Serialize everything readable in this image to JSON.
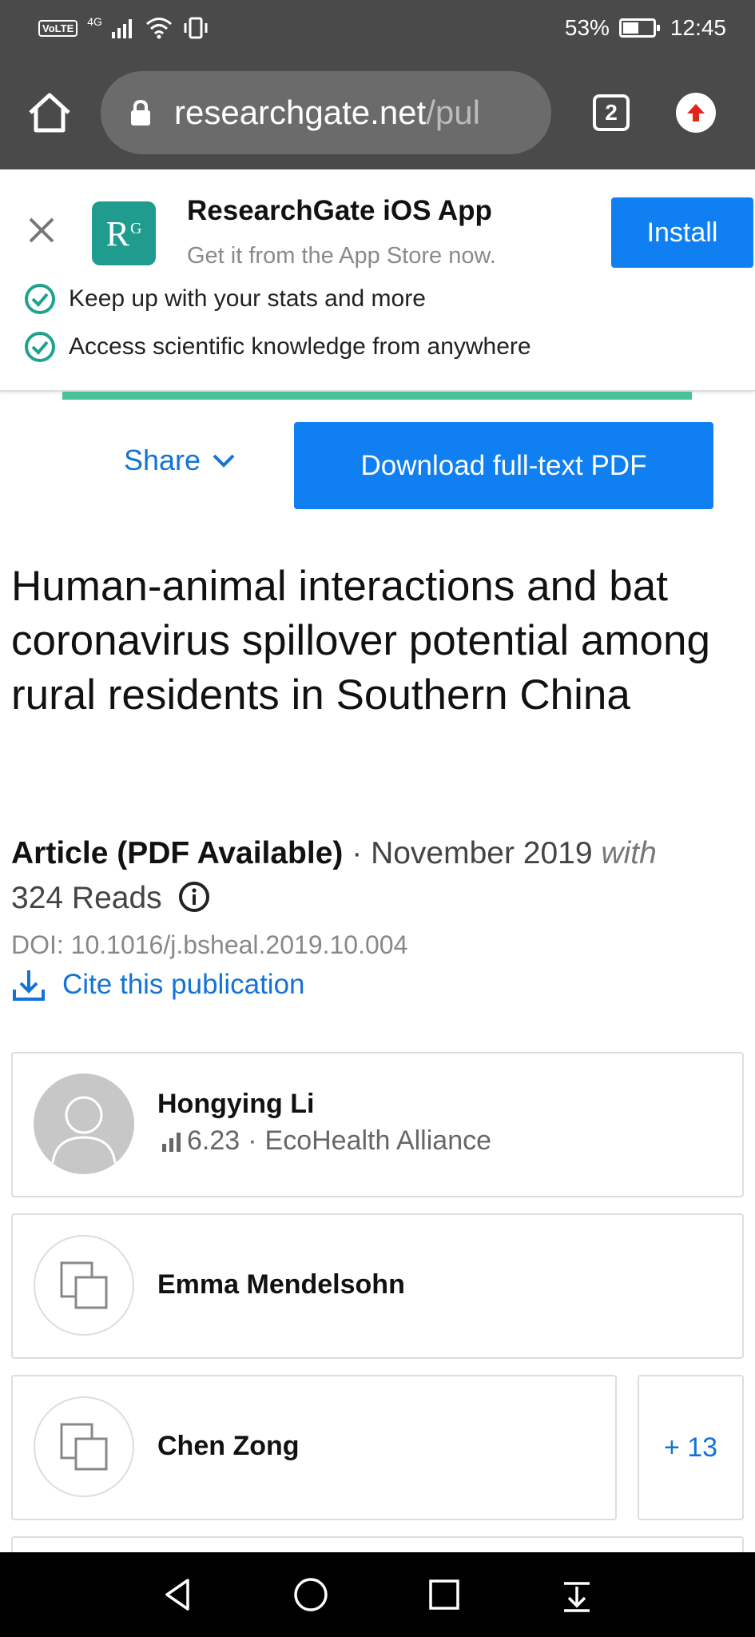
{
  "status_bar": {
    "network_label": "VoLTE",
    "network_gen": "4G",
    "battery_percent": "53%",
    "battery_level": 0.53,
    "time": "12:45"
  },
  "browser": {
    "url_host": "researchgate.net",
    "url_path": "/pul",
    "tab_count": "2",
    "home_icon": "home-icon",
    "lock_icon": "lock-icon",
    "update_icon": "upload-arrow-icon"
  },
  "app_banner": {
    "title": "ResearchGate iOS App",
    "subtitle": "Get it from the App Store now.",
    "install_label": "Install",
    "logo_text": "R",
    "logo_sup": "G",
    "perks": [
      "Keep up with your stats and more",
      "Access scientific knowledge from anywhere"
    ]
  },
  "actions": {
    "share_label": "Share",
    "download_label": "Download full-text PDF"
  },
  "publication": {
    "title": "Human-animal interactions and bat coronavirus spillover potential among rural residents in Southern China",
    "type": "Article (PDF Available)",
    "separator": " · ",
    "date": "November 2019",
    "with_label": "with",
    "reads": "324 Reads",
    "doi": "DOI: 10.1016/j.bsheal.2019.10.004",
    "cite_label": "Cite this publication"
  },
  "authors": [
    {
      "name": "Hongying Li",
      "score": "6.23",
      "institution": "EcoHealth Alliance",
      "separator": "·"
    },
    {
      "name": "Emma Mendelsohn"
    },
    {
      "name": "Chen Zong"
    }
  ],
  "more_authors_label": "+ 13",
  "colors": {
    "brand_blue": "#0f7ff2",
    "link_blue": "#1373d6",
    "rg_teal": "#1f9c8d",
    "check_green": "#1fa38c",
    "strip_green": "#49c29a"
  }
}
